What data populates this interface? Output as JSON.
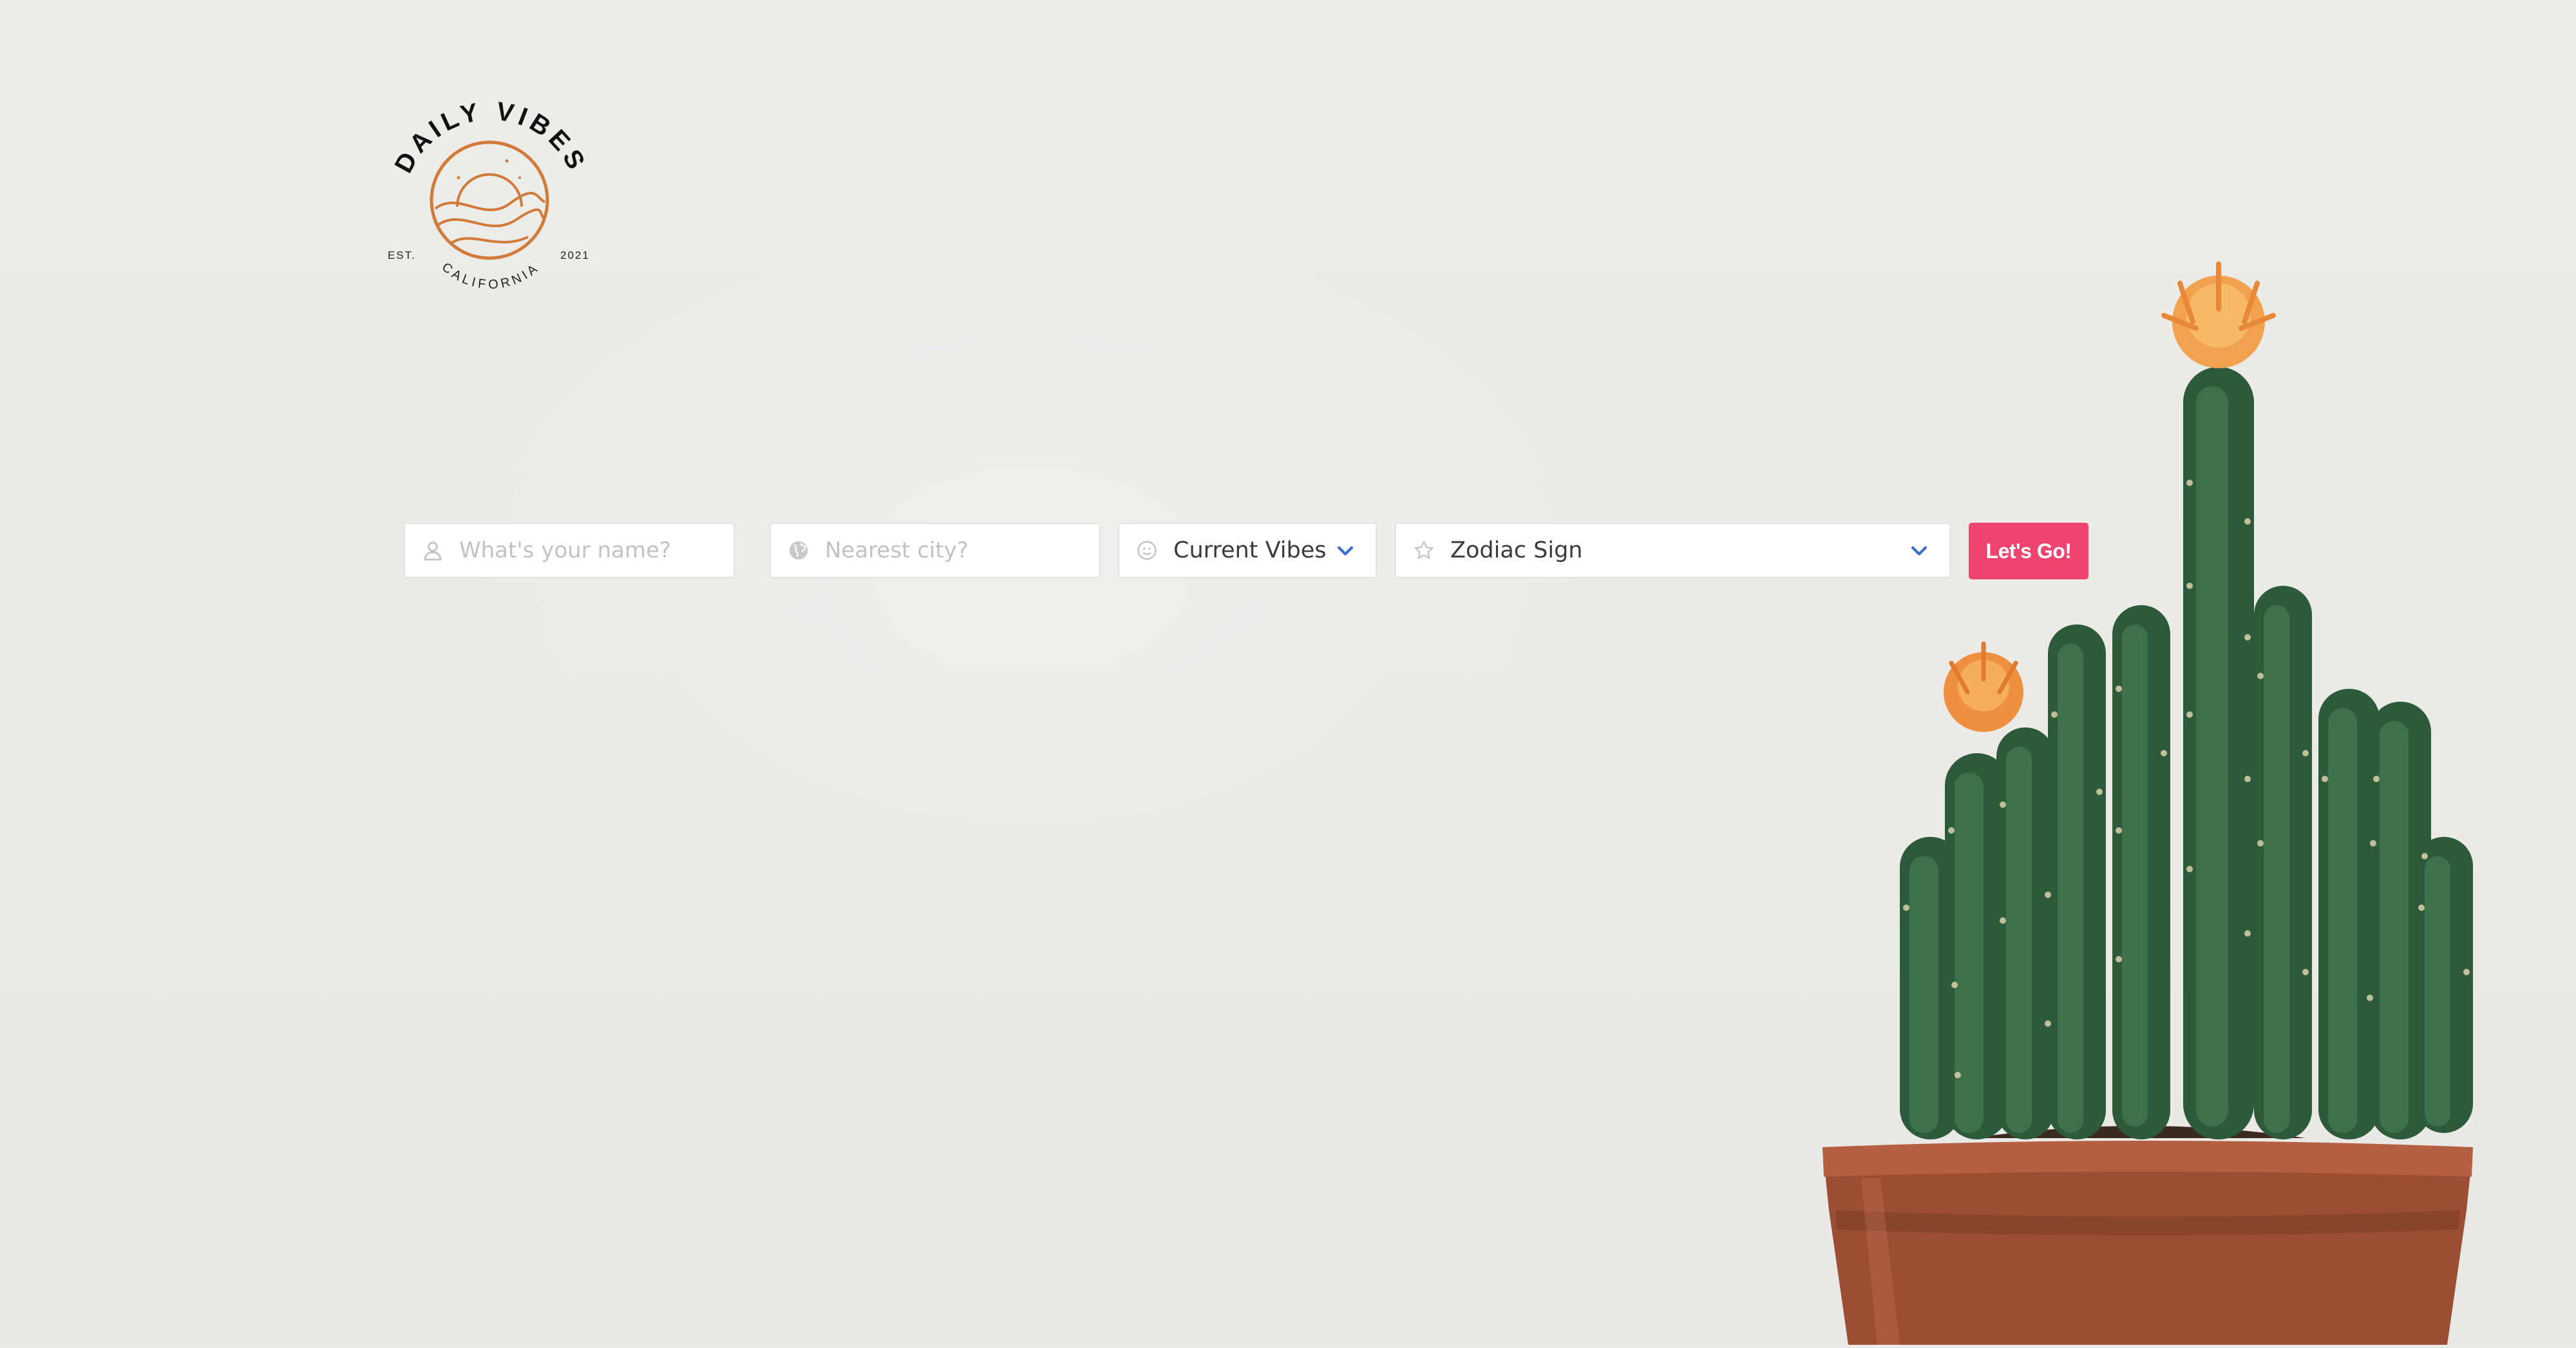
{
  "logo": {
    "top_text": "DAILY VIBES",
    "est_label": "EST.",
    "year": "2021",
    "location": "CALIFORNIA"
  },
  "form": {
    "name": {
      "placeholder": "What's your name?",
      "icon": "user-icon"
    },
    "city": {
      "placeholder": "Nearest city?",
      "icon": "globe-icon"
    },
    "vibes": {
      "value": "Current Vibes",
      "icon": "smiley-icon",
      "chevron": "chevron-down-icon"
    },
    "zodiac": {
      "value": "Zodiac Sign",
      "icon": "star-icon",
      "chevron": "chevron-down-icon"
    },
    "submit_label": "Let's Go!"
  },
  "colors": {
    "background": "#ecebe8",
    "accent": "#ef4470",
    "logo_orange": "#d27a3a",
    "chevron_blue": "#3b6fd1"
  },
  "illustration": {
    "subject": "cactus-in-pot-image"
  }
}
